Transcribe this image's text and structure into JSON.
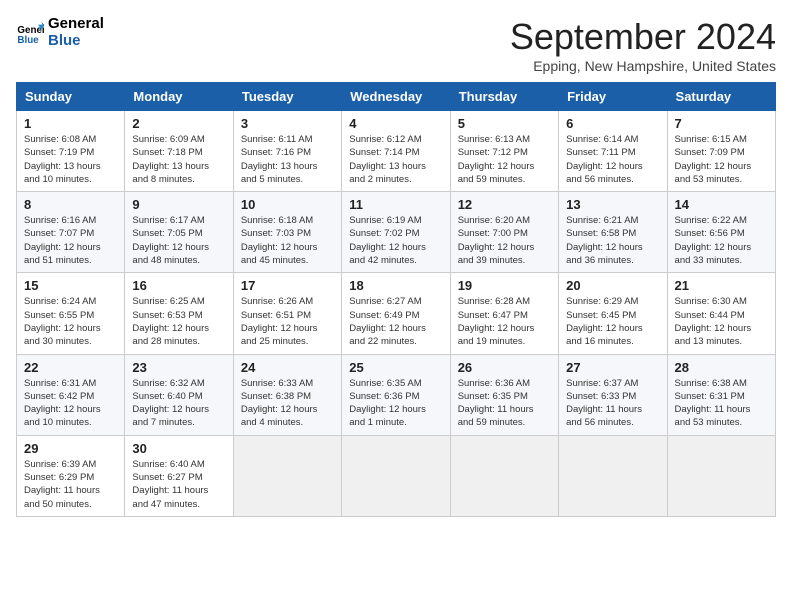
{
  "header": {
    "logo_line1": "General",
    "logo_line2": "Blue",
    "month_title": "September 2024",
    "location": "Epping, New Hampshire, United States"
  },
  "days_of_week": [
    "Sunday",
    "Monday",
    "Tuesday",
    "Wednesday",
    "Thursday",
    "Friday",
    "Saturday"
  ],
  "weeks": [
    [
      {
        "day": 1,
        "lines": [
          "Sunrise: 6:08 AM",
          "Sunset: 7:19 PM",
          "Daylight: 13 hours",
          "and 10 minutes."
        ]
      },
      {
        "day": 2,
        "lines": [
          "Sunrise: 6:09 AM",
          "Sunset: 7:18 PM",
          "Daylight: 13 hours",
          "and 8 minutes."
        ]
      },
      {
        "day": 3,
        "lines": [
          "Sunrise: 6:11 AM",
          "Sunset: 7:16 PM",
          "Daylight: 13 hours",
          "and 5 minutes."
        ]
      },
      {
        "day": 4,
        "lines": [
          "Sunrise: 6:12 AM",
          "Sunset: 7:14 PM",
          "Daylight: 13 hours",
          "and 2 minutes."
        ]
      },
      {
        "day": 5,
        "lines": [
          "Sunrise: 6:13 AM",
          "Sunset: 7:12 PM",
          "Daylight: 12 hours",
          "and 59 minutes."
        ]
      },
      {
        "day": 6,
        "lines": [
          "Sunrise: 6:14 AM",
          "Sunset: 7:11 PM",
          "Daylight: 12 hours",
          "and 56 minutes."
        ]
      },
      {
        "day": 7,
        "lines": [
          "Sunrise: 6:15 AM",
          "Sunset: 7:09 PM",
          "Daylight: 12 hours",
          "and 53 minutes."
        ]
      }
    ],
    [
      {
        "day": 8,
        "lines": [
          "Sunrise: 6:16 AM",
          "Sunset: 7:07 PM",
          "Daylight: 12 hours",
          "and 51 minutes."
        ]
      },
      {
        "day": 9,
        "lines": [
          "Sunrise: 6:17 AM",
          "Sunset: 7:05 PM",
          "Daylight: 12 hours",
          "and 48 minutes."
        ]
      },
      {
        "day": 10,
        "lines": [
          "Sunrise: 6:18 AM",
          "Sunset: 7:03 PM",
          "Daylight: 12 hours",
          "and 45 minutes."
        ]
      },
      {
        "day": 11,
        "lines": [
          "Sunrise: 6:19 AM",
          "Sunset: 7:02 PM",
          "Daylight: 12 hours",
          "and 42 minutes."
        ]
      },
      {
        "day": 12,
        "lines": [
          "Sunrise: 6:20 AM",
          "Sunset: 7:00 PM",
          "Daylight: 12 hours",
          "and 39 minutes."
        ]
      },
      {
        "day": 13,
        "lines": [
          "Sunrise: 6:21 AM",
          "Sunset: 6:58 PM",
          "Daylight: 12 hours",
          "and 36 minutes."
        ]
      },
      {
        "day": 14,
        "lines": [
          "Sunrise: 6:22 AM",
          "Sunset: 6:56 PM",
          "Daylight: 12 hours",
          "and 33 minutes."
        ]
      }
    ],
    [
      {
        "day": 15,
        "lines": [
          "Sunrise: 6:24 AM",
          "Sunset: 6:55 PM",
          "Daylight: 12 hours",
          "and 30 minutes."
        ]
      },
      {
        "day": 16,
        "lines": [
          "Sunrise: 6:25 AM",
          "Sunset: 6:53 PM",
          "Daylight: 12 hours",
          "and 28 minutes."
        ]
      },
      {
        "day": 17,
        "lines": [
          "Sunrise: 6:26 AM",
          "Sunset: 6:51 PM",
          "Daylight: 12 hours",
          "and 25 minutes."
        ]
      },
      {
        "day": 18,
        "lines": [
          "Sunrise: 6:27 AM",
          "Sunset: 6:49 PM",
          "Daylight: 12 hours",
          "and 22 minutes."
        ]
      },
      {
        "day": 19,
        "lines": [
          "Sunrise: 6:28 AM",
          "Sunset: 6:47 PM",
          "Daylight: 12 hours",
          "and 19 minutes."
        ]
      },
      {
        "day": 20,
        "lines": [
          "Sunrise: 6:29 AM",
          "Sunset: 6:45 PM",
          "Daylight: 12 hours",
          "and 16 minutes."
        ]
      },
      {
        "day": 21,
        "lines": [
          "Sunrise: 6:30 AM",
          "Sunset: 6:44 PM",
          "Daylight: 12 hours",
          "and 13 minutes."
        ]
      }
    ],
    [
      {
        "day": 22,
        "lines": [
          "Sunrise: 6:31 AM",
          "Sunset: 6:42 PM",
          "Daylight: 12 hours",
          "and 10 minutes."
        ]
      },
      {
        "day": 23,
        "lines": [
          "Sunrise: 6:32 AM",
          "Sunset: 6:40 PM",
          "Daylight: 12 hours",
          "and 7 minutes."
        ]
      },
      {
        "day": 24,
        "lines": [
          "Sunrise: 6:33 AM",
          "Sunset: 6:38 PM",
          "Daylight: 12 hours",
          "and 4 minutes."
        ]
      },
      {
        "day": 25,
        "lines": [
          "Sunrise: 6:35 AM",
          "Sunset: 6:36 PM",
          "Daylight: 12 hours",
          "and 1 minute."
        ]
      },
      {
        "day": 26,
        "lines": [
          "Sunrise: 6:36 AM",
          "Sunset: 6:35 PM",
          "Daylight: 11 hours",
          "and 59 minutes."
        ]
      },
      {
        "day": 27,
        "lines": [
          "Sunrise: 6:37 AM",
          "Sunset: 6:33 PM",
          "Daylight: 11 hours",
          "and 56 minutes."
        ]
      },
      {
        "day": 28,
        "lines": [
          "Sunrise: 6:38 AM",
          "Sunset: 6:31 PM",
          "Daylight: 11 hours",
          "and 53 minutes."
        ]
      }
    ],
    [
      {
        "day": 29,
        "lines": [
          "Sunrise: 6:39 AM",
          "Sunset: 6:29 PM",
          "Daylight: 11 hours",
          "and 50 minutes."
        ]
      },
      {
        "day": 30,
        "lines": [
          "Sunrise: 6:40 AM",
          "Sunset: 6:27 PM",
          "Daylight: 11 hours",
          "and 47 minutes."
        ]
      },
      {
        "day": null,
        "lines": []
      },
      {
        "day": null,
        "lines": []
      },
      {
        "day": null,
        "lines": []
      },
      {
        "day": null,
        "lines": []
      },
      {
        "day": null,
        "lines": []
      }
    ]
  ]
}
